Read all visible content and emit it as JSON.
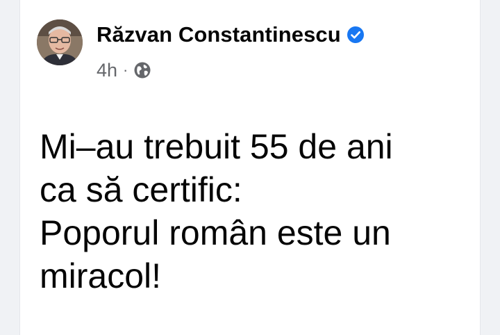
{
  "post": {
    "author": "Răzvan Constantinescu",
    "verified": true,
    "time": "4h",
    "separator": "·",
    "audience_icon": "globe-icon",
    "text_lines": [
      "Mi–au trebuit 55 de ani",
      "ca să certific:",
      "Poporul român este un",
      "miracol!"
    ]
  },
  "colors": {
    "name": "#050505",
    "meta": "#65676b",
    "verified_badge": "#1877f2",
    "background": "#ffffff"
  }
}
